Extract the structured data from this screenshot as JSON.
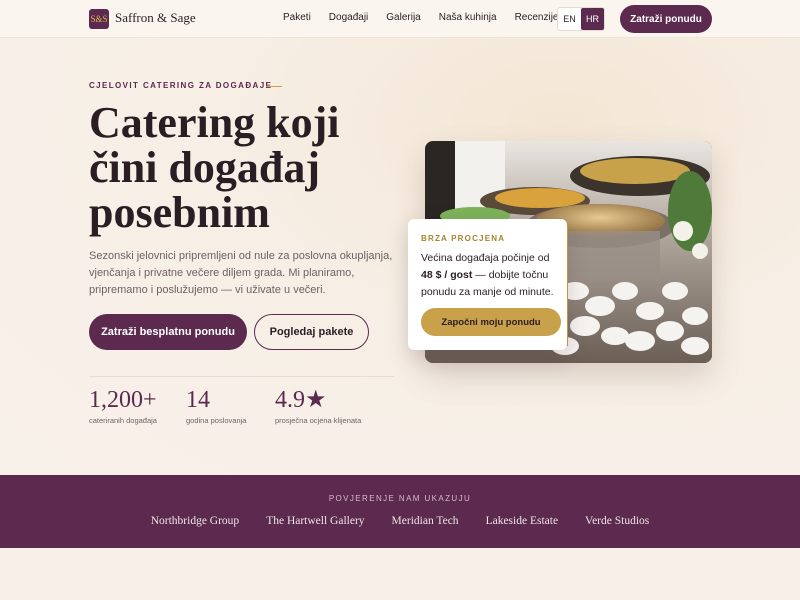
{
  "brand": {
    "mark": "S&S",
    "name": "Saffron & Sage"
  },
  "nav": {
    "items": [
      "Paketi",
      "Događaji",
      "Galerija",
      "Naša kuhinja",
      "Recenzije"
    ]
  },
  "lang": {
    "options": [
      "EN",
      "HR"
    ],
    "active": "HR"
  },
  "header_cta": "Zatraži ponudu",
  "hero": {
    "eyebrow": "CJELOVIT CATERING ZA DOGAĐAJE",
    "title_lines": [
      "Catering koji",
      "čini događaj",
      "posebnim"
    ],
    "subtitle": "Sezonski jelovnici pripremljeni od nule za poslovna okupljanja, vjenčanja i privatne večere diljem grada. Mi planiramo, pripremamo i poslužujemo — vi uživate u večeri.",
    "primary_button": "Zatraži besplatnu ponudu",
    "secondary_button": "Pogledaj pakete"
  },
  "stats": [
    {
      "value": "1,200+",
      "label": "cateriranih događaja"
    },
    {
      "value": "14",
      "label": "godina poslovanja"
    },
    {
      "value": "4.9★",
      "label": "prosječna ocjena klijenata"
    }
  ],
  "quote_card": {
    "title": "BRZA PROCJENA",
    "text_before": "Većina događaja počinje od",
    "price": "48 $ / gost",
    "text_after": "— dobijte točnu ponudu za manje od minute.",
    "button": "Započni moju ponudu"
  },
  "trusted": {
    "title": "POVJERENJE NAM UKAZUJU",
    "clients": [
      "Northbridge Group",
      "The Hartwell Gallery",
      "Meridian Tech",
      "Lakeside Estate",
      "Verde Studios"
    ]
  },
  "colors": {
    "primary": "#5b2a4e",
    "accent": "#c9a14a",
    "background": "#f8f0e8"
  }
}
